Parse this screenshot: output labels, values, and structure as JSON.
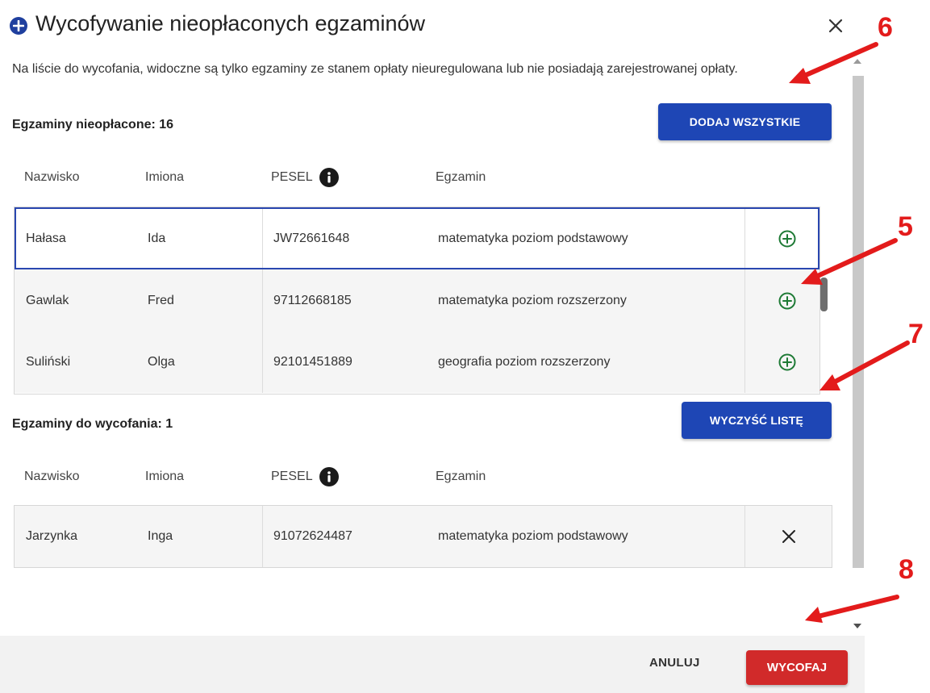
{
  "dialog": {
    "title": "Wycofywanie nieopłaconych egzaminów",
    "info": "Na liście do wycofania, widoczne są tylko egzaminy ze stanem opłaty nieuregulowana lub nie posiadają zarejestrowanej opłaty."
  },
  "unpaid": {
    "title": "Egzaminy nieopłacone: 16",
    "add_all_label": "DODAJ WSZYSTKIE",
    "columns": [
      "Nazwisko",
      "Imiona",
      "PESEL",
      "Egzamin"
    ],
    "rows": [
      {
        "nazwisko": "Hałasa",
        "imiona": "Ida",
        "pesel": "JW72661648",
        "egzamin": "matematyka poziom podstawowy"
      },
      {
        "nazwisko": "Gawlak",
        "imiona": "Fred",
        "pesel": "97112668185",
        "egzamin": "matematyka poziom rozszerzony"
      },
      {
        "nazwisko": "Suliński",
        "imiona": "Olga",
        "pesel": "92101451889",
        "egzamin": "geografia poziom rozszerzony"
      }
    ]
  },
  "withdraw": {
    "title": "Egzaminy do wycofania: 1",
    "clear_label": "WYCZYŚĆ LISTĘ",
    "columns": [
      "Nazwisko",
      "Imiona",
      "PESEL",
      "Egzamin"
    ],
    "rows": [
      {
        "nazwisko": "Jarzynka",
        "imiona": "Inga",
        "pesel": "91072624487",
        "egzamin": "matematyka poziom podstawowy"
      }
    ]
  },
  "footer": {
    "cancel_label": "ANULUJ",
    "withdraw_label": "WYCOFAJ"
  },
  "annotations": [
    "6",
    "5",
    "7",
    "8"
  ],
  "colors": {
    "primary": "#1e46b5",
    "danger": "#d12a2a",
    "add_icon": "#1e7a35",
    "annotation": "#e31b1b"
  }
}
